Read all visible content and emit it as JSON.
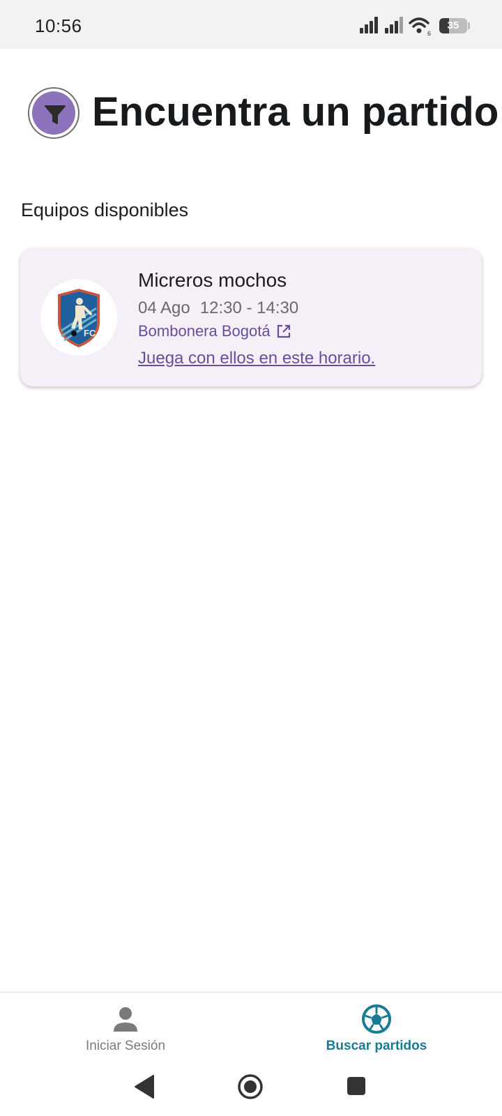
{
  "status_bar": {
    "time": "10:56",
    "battery_level": "35",
    "icons": [
      "signal-icon",
      "signal-icon",
      "wifi-icon",
      "battery-icon"
    ]
  },
  "header": {
    "title": "Encuentra un partido",
    "filter_icon": "filter-icon"
  },
  "section": {
    "title": "Equipos disponibles"
  },
  "teams": [
    {
      "name": "Micreros mochos",
      "date": "04 Ago",
      "time": "12:30 - 14:30",
      "venue": "Bombonera Bogotá",
      "link": "Juega con ellos en este horario.",
      "logo_text": "FC"
    }
  ],
  "bottom_nav": {
    "items": [
      {
        "label": "Iniciar Sesión",
        "icon": "person-icon",
        "active": false
      },
      {
        "label": "Buscar partidos",
        "icon": "soccer-ball-icon",
        "active": true
      }
    ]
  },
  "colors": {
    "accent": "#8c73bb",
    "link": "#6a4c9c",
    "nav_active": "#1a7b95",
    "card_bg": "#f5f0f7"
  }
}
